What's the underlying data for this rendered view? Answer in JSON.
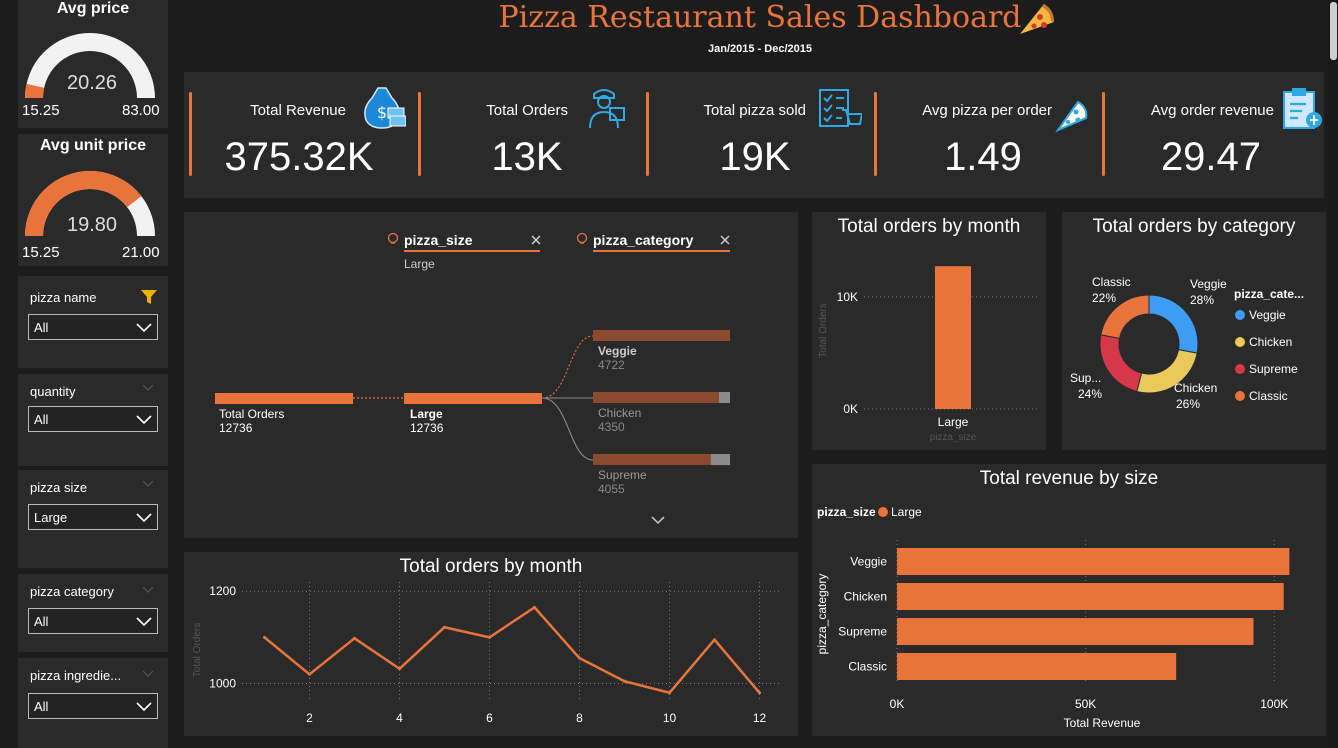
{
  "header": {
    "title": "Pizza Restaurant Sales Dashboard",
    "subtitle": "Jan/2015 - Dec/2015"
  },
  "sidebar": {
    "avg_price": {
      "title": "Avg price",
      "value": "20.26",
      "min": "15.25",
      "max": "83.00",
      "fraction": 0.07
    },
    "avg_unit_price": {
      "title": "Avg unit price",
      "value": "19.80",
      "min": "15.25",
      "max": "21.00",
      "fraction": 0.79
    },
    "slicers": [
      {
        "label": "pizza name",
        "value": "All"
      },
      {
        "label": "quantity",
        "value": "All"
      },
      {
        "label": "pizza size",
        "value": "Large"
      },
      {
        "label": "pizza category",
        "value": "All"
      },
      {
        "label": "pizza ingredie...",
        "value": "All"
      }
    ]
  },
  "kpis": [
    {
      "label": "Total Revenue",
      "value": "375.32K",
      "icon": "money-bag-icon"
    },
    {
      "label": "Total Orders",
      "value": "13K",
      "icon": "delivery-person-icon"
    },
    {
      "label": "Total pizza sold",
      "value": "19K",
      "icon": "checklist-cart-icon"
    },
    {
      "label": "Avg pizza per order",
      "value": "1.49",
      "icon": "pizza-slice-icon"
    },
    {
      "label": "Avg order revenue",
      "value": "29.47",
      "icon": "clipboard-icon"
    }
  ],
  "decomp_tree": {
    "filters": [
      {
        "field": "pizza_size",
        "value": "Large"
      },
      {
        "field": "pizza_category",
        "value": ""
      }
    ],
    "root": {
      "label": "Total Orders",
      "value": "12736"
    },
    "level1": {
      "label": "Large",
      "value": "12736"
    },
    "level2": [
      {
        "label": "Veggie",
        "value": "4722",
        "fraction": 1.0
      },
      {
        "label": "Chicken",
        "value": "4350",
        "fraction": 0.92
      },
      {
        "label": "Supreme",
        "value": "4055",
        "fraction": 0.86
      }
    ]
  },
  "colors": {
    "accent": "#e8743b",
    "panel": "#2a2a2a",
    "bg": "#1c1c1c",
    "veggie": "#3d9df5",
    "chicken": "#e8c95a",
    "supreme": "#d6384a",
    "classic": "#e8743b"
  },
  "charts": [
    {
      "title": "Total orders by month",
      "chart_data": {
        "type": "bar",
        "categories": [
          "Large"
        ],
        "values": [
          12736
        ],
        "xlabel": "pizza_size",
        "ylabel": "Total Orders",
        "ylim": [
          0,
          14000
        ],
        "yticks": [
          0,
          10000
        ],
        "yticklabels": [
          "0K",
          "10K"
        ],
        "grid": true
      }
    },
    {
      "title": "Total orders by category",
      "chart_data": {
        "type": "pie",
        "legend_title": "pizza_cate...",
        "categories": [
          "Veggie",
          "Chicken",
          "Supreme",
          "Classic"
        ],
        "values": [
          28,
          26,
          24,
          22
        ],
        "labels": [
          "28%",
          "26%",
          "24%",
          "22%"
        ],
        "slice_labels": [
          "Veggie",
          "Chicken",
          "Sup...",
          "Classic"
        ],
        "legend_placement": "right"
      }
    },
    {
      "title": "Total revenue by size",
      "chart_data": {
        "type": "bar",
        "orientation": "horizontal",
        "legend_title": "pizza_size",
        "series": [
          {
            "name": "Large",
            "values": [
              104000,
              102500,
              94500,
              74000
            ]
          }
        ],
        "categories": [
          "Veggie",
          "Chicken",
          "Supreme",
          "Classic"
        ],
        "xlabel": "Total Revenue",
        "ylabel": "pizza_category",
        "xlim": [
          0,
          110000
        ],
        "xticks": [
          0,
          50000,
          100000
        ],
        "xticklabels": [
          "0K",
          "50K",
          "100K"
        ],
        "grid": true
      }
    },
    {
      "title": "Total orders by month",
      "chart_data": {
        "type": "line",
        "x": [
          1,
          2,
          3,
          4,
          5,
          6,
          7,
          8,
          9,
          10,
          11,
          12
        ],
        "values": [
          1100,
          1020,
          1098,
          1032,
          1122,
          1100,
          1165,
          1055,
          1005,
          980,
          1095,
          980
        ],
        "xlabel": "",
        "ylabel": "Total Orders",
        "xticks": [
          2,
          4,
          6,
          8,
          10,
          12
        ],
        "ylim": [
          960,
          1220
        ],
        "yticks": [
          1000,
          1200
        ],
        "grid": true
      }
    }
  ]
}
